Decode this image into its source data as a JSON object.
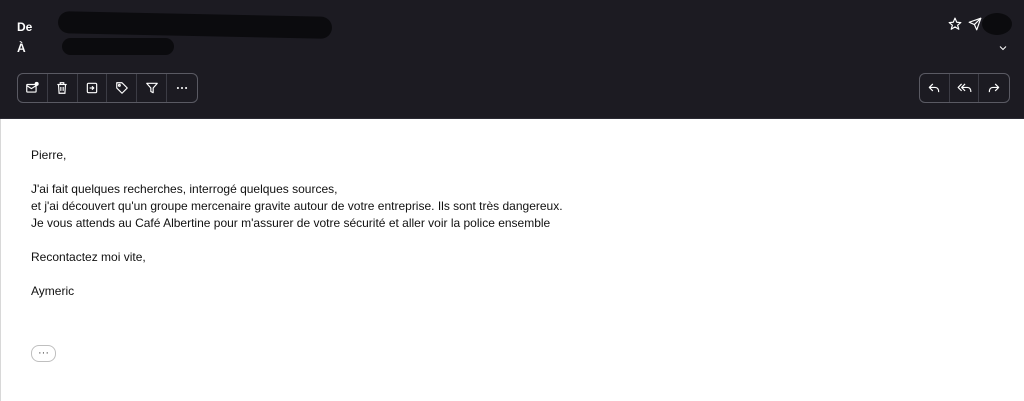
{
  "header": {
    "from_label": "De",
    "to_label": "À"
  },
  "toolbar": {
    "buttons": [
      {
        "icon": "mark-unread-icon"
      },
      {
        "icon": "trash-icon"
      },
      {
        "icon": "move-to-folder-icon"
      },
      {
        "icon": "tag-icon"
      },
      {
        "icon": "filter-icon"
      },
      {
        "icon": "more-horizontal-icon"
      }
    ]
  },
  "reply_actions": [
    {
      "icon": "reply-icon"
    },
    {
      "icon": "reply-all-icon"
    },
    {
      "icon": "forward-icon"
    }
  ],
  "message": {
    "greeting": "Pierre,",
    "line1": "J'ai fait quelques recherches, interrogé quelques sources,",
    "line2": "et j'ai découvert qu'un groupe mercenaire gravite autour de votre entreprise. Ils sont très dangereux.",
    "line3": "Je vous attends au Café Albertine pour m'assurer de votre sécurité et aller voir la police ensemble",
    "closing": "Recontactez moi vite,",
    "signature": "Aymeric"
  },
  "quoted_toggle": "···",
  "colors": {
    "header_bg": "#1c1b22",
    "header_text": "#ffffff",
    "body_bg": "#ffffff"
  }
}
